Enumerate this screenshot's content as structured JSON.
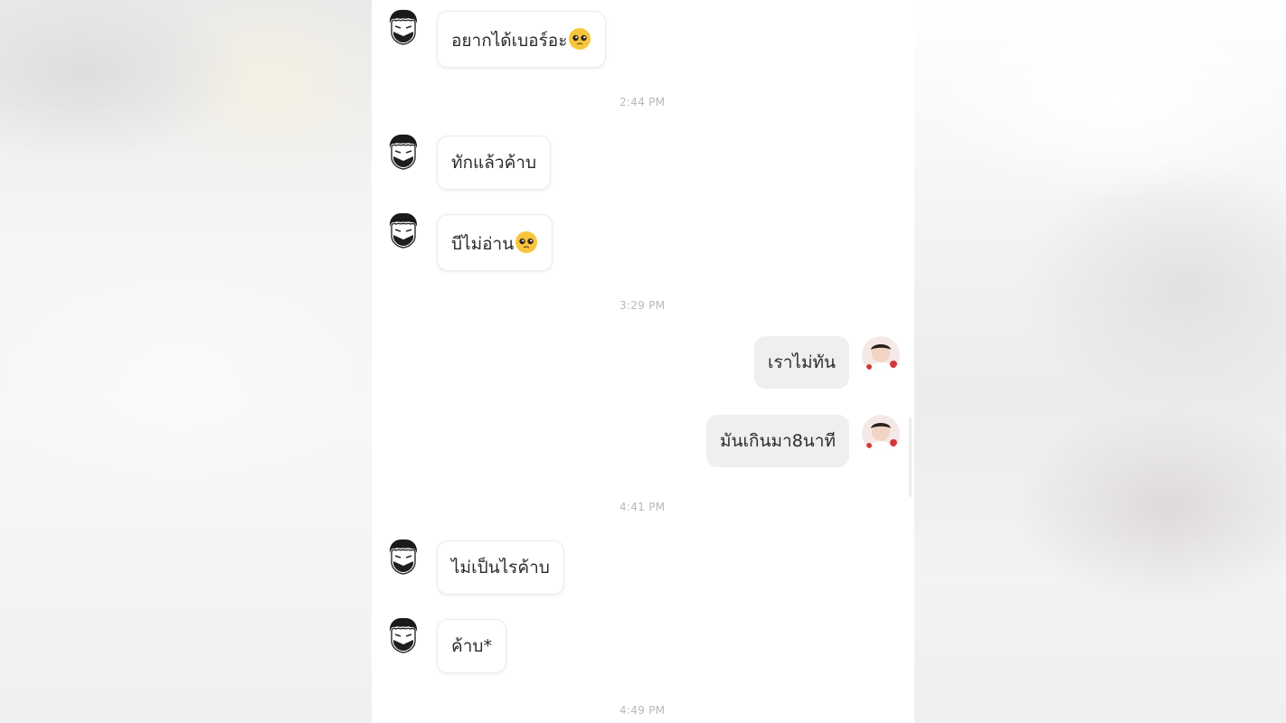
{
  "messages": [
    {
      "text": "อยากได้เบอร์อะ",
      "emoji": "pleading-face-emoji"
    },
    {
      "text": "ทักแล้วค้าบ"
    },
    {
      "text": "บีไม่อ่าน",
      "emoji": "pleading-face-emoji"
    },
    {
      "text": "เราไม่ทัน"
    },
    {
      "text": "มันเกินมา8นาที"
    },
    {
      "text": "ไม่เป็นไรค้าบ"
    },
    {
      "text": "ค้าบ*"
    }
  ],
  "timestamps": [
    "2:44 PM",
    "3:29 PM",
    "4:41 PM",
    "4:49 PM"
  ],
  "colors": {
    "bubble_incoming": "#ffffff",
    "bubble_outgoing": "#efefef",
    "timestamp": "#b8b8b8",
    "text": "#2b2b2b"
  }
}
